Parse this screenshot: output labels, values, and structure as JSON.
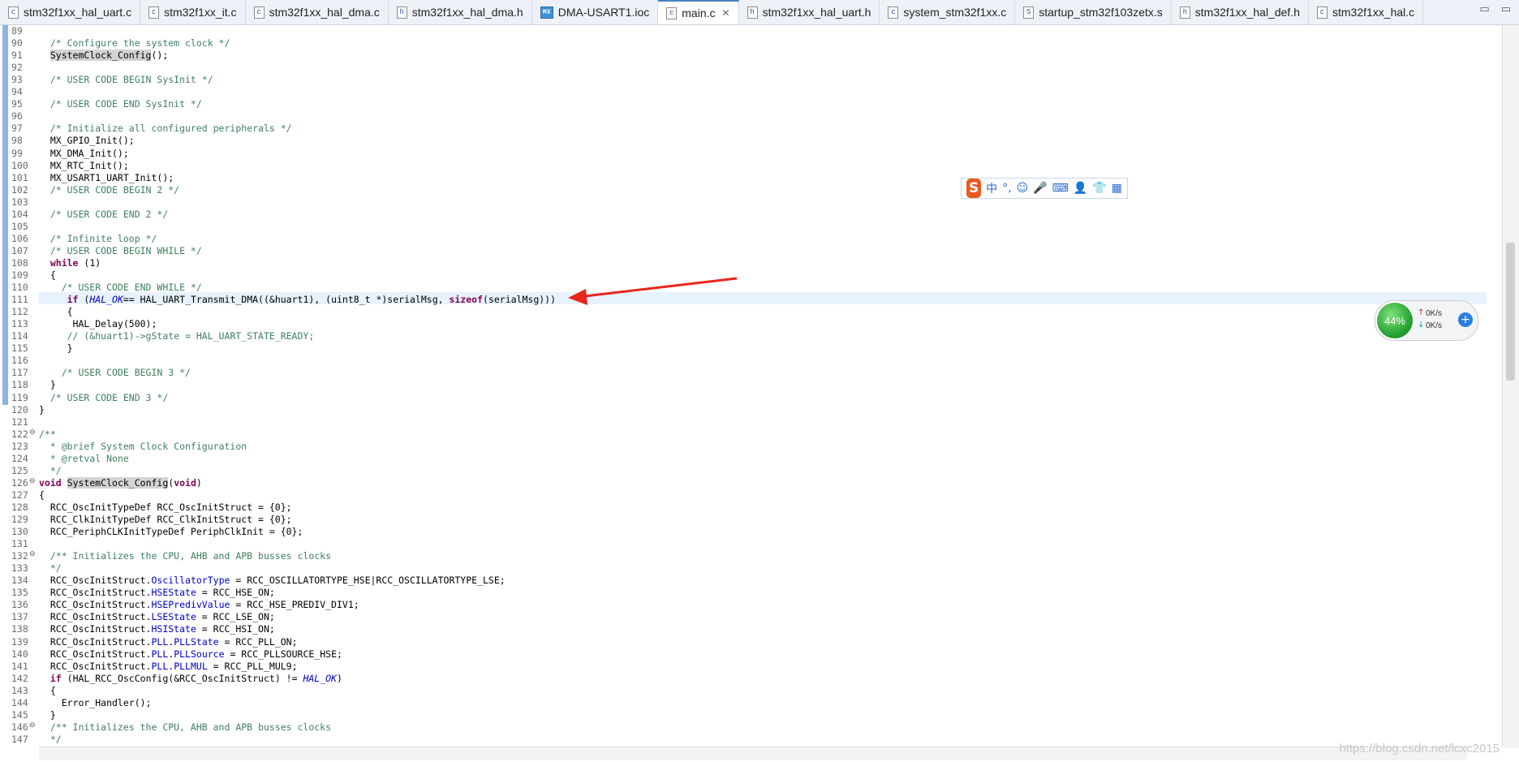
{
  "tabs": [
    {
      "icon": "c-file-icon",
      "glyph": "c",
      "label": "stm32f1xx_hal_uart.c",
      "active": false
    },
    {
      "icon": "c-file-icon",
      "glyph": "c",
      "label": "stm32f1xx_it.c",
      "active": false
    },
    {
      "icon": "c-file-icon",
      "glyph": "c",
      "label": "stm32f1xx_hal_dma.c",
      "active": false
    },
    {
      "icon": "h-file-icon",
      "glyph": "h",
      "label": "stm32f1xx_hal_dma.h",
      "active": false
    },
    {
      "icon": "mx-file-icon",
      "glyph": "MX",
      "label": "DMA-USART1.ioc",
      "active": false
    },
    {
      "icon": "c-file-icon",
      "glyph": "c",
      "label": "main.c",
      "active": true
    },
    {
      "icon": "h-file-icon",
      "glyph": "h",
      "label": "stm32f1xx_hal_uart.h",
      "active": false
    },
    {
      "icon": "c-file-icon",
      "glyph": "c",
      "label": "system_stm32f1xx.c",
      "active": false
    },
    {
      "icon": "s-file-icon",
      "glyph": "S",
      "label": "startup_stm32f103zetx.s",
      "active": false
    },
    {
      "icon": "h-file-icon",
      "glyph": "h",
      "label": "stm32f1xx_hal_def.h",
      "active": false
    },
    {
      "icon": "c-file-icon",
      "glyph": "c",
      "label": "stm32f1xx_hal.c",
      "active": false
    }
  ],
  "window_controls": {
    "minimize": "▭",
    "restore": "▭"
  },
  "code_lines": [
    {
      "n": "89",
      "t": ""
    },
    {
      "n": "90",
      "t": "  /* Configure the system clock */"
    },
    {
      "n": "91",
      "t": "  SystemClock_Config();"
    },
    {
      "n": "92",
      "t": ""
    },
    {
      "n": "93",
      "t": "  /* USER CODE BEGIN SysInit */"
    },
    {
      "n": "94",
      "t": ""
    },
    {
      "n": "95",
      "t": "  /* USER CODE END SysInit */"
    },
    {
      "n": "96",
      "t": ""
    },
    {
      "n": "97",
      "t": "  /* Initialize all configured peripherals */"
    },
    {
      "n": "98",
      "t": "  MX_GPIO_Init();"
    },
    {
      "n": "99",
      "t": "  MX_DMA_Init();"
    },
    {
      "n": "100",
      "t": "  MX_RTC_Init();"
    },
    {
      "n": "101",
      "t": "  MX_USART1_UART_Init();"
    },
    {
      "n": "102",
      "t": "  /* USER CODE BEGIN 2 */"
    },
    {
      "n": "103",
      "t": ""
    },
    {
      "n": "104",
      "t": "  /* USER CODE END 2 */"
    },
    {
      "n": "105",
      "t": ""
    },
    {
      "n": "106",
      "t": "  /* Infinite loop */"
    },
    {
      "n": "107",
      "t": "  /* USER CODE BEGIN WHILE */"
    },
    {
      "n": "108",
      "t": "  while (1)"
    },
    {
      "n": "109",
      "t": "  {"
    },
    {
      "n": "110",
      "t": "    /* USER CODE END WHILE */"
    },
    {
      "n": "111",
      "t": "     if (HAL_OK== HAL_UART_Transmit_DMA((&huart1), (uint8_t *)serialMsg, sizeof(serialMsg)))"
    },
    {
      "n": "112",
      "t": "     {"
    },
    {
      "n": "113",
      "t": "      HAL_Delay(500);"
    },
    {
      "n": "114",
      "t": "     // (&huart1)->gState = HAL_UART_STATE_READY;"
    },
    {
      "n": "115",
      "t": "     }"
    },
    {
      "n": "116",
      "t": ""
    },
    {
      "n": "117",
      "t": "    /* USER CODE BEGIN 3 */"
    },
    {
      "n": "118",
      "t": "  }"
    },
    {
      "n": "119",
      "t": "  /* USER CODE END 3 */"
    },
    {
      "n": "120",
      "t": "}"
    },
    {
      "n": "121",
      "t": ""
    },
    {
      "n": "122",
      "t": "/**"
    },
    {
      "n": "123",
      "t": "  * @brief System Clock Configuration"
    },
    {
      "n": "124",
      "t": "  * @retval None"
    },
    {
      "n": "125",
      "t": "  */"
    },
    {
      "n": "126",
      "t": "void SystemClock_Config(void)"
    },
    {
      "n": "127",
      "t": "{"
    },
    {
      "n": "128",
      "t": "  RCC_OscInitTypeDef RCC_OscInitStruct = {0};"
    },
    {
      "n": "129",
      "t": "  RCC_ClkInitTypeDef RCC_ClkInitStruct = {0};"
    },
    {
      "n": "130",
      "t": "  RCC_PeriphCLKInitTypeDef PeriphClkInit = {0};"
    },
    {
      "n": "131",
      "t": ""
    },
    {
      "n": "132",
      "t": "  /** Initializes the CPU, AHB and APB busses clocks"
    },
    {
      "n": "133",
      "t": "  */"
    },
    {
      "n": "134",
      "t": "  RCC_OscInitStruct.OscillatorType = RCC_OSCILLATORTYPE_HSE|RCC_OSCILLATORTYPE_LSE;"
    },
    {
      "n": "135",
      "t": "  RCC_OscInitStruct.HSEState = RCC_HSE_ON;"
    },
    {
      "n": "136",
      "t": "  RCC_OscInitStruct.HSEPredivValue = RCC_HSE_PREDIV_DIV1;"
    },
    {
      "n": "137",
      "t": "  RCC_OscInitStruct.LSEState = RCC_LSE_ON;"
    },
    {
      "n": "138",
      "t": "  RCC_OscInitStruct.HSIState = RCC_HSI_ON;"
    },
    {
      "n": "139",
      "t": "  RCC_OscInitStruct.PLL.PLLState = RCC_PLL_ON;"
    },
    {
      "n": "140",
      "t": "  RCC_OscInitStruct.PLL.PLLSource = RCC_PLLSOURCE_HSE;"
    },
    {
      "n": "141",
      "t": "  RCC_OscInitStruct.PLL.PLLMUL = RCC_PLL_MUL9;"
    },
    {
      "n": "142",
      "t": "  if (HAL_RCC_OscConfig(&RCC_OscInitStruct) != HAL_OK)"
    },
    {
      "n": "143",
      "t": "  {"
    },
    {
      "n": "144",
      "t": "    Error_Handler();"
    },
    {
      "n": "145",
      "t": "  }"
    },
    {
      "n": "146",
      "t": "  /** Initializes the CPU, AHB and APB busses clocks"
    },
    {
      "n": "147",
      "t": "  */"
    }
  ],
  "ime_toolbar": {
    "logo": "S",
    "items": [
      "中",
      "°,",
      "☺",
      "🎤",
      "⌨",
      "👤",
      "👕",
      "▦"
    ]
  },
  "net_widget": {
    "percent": "44%",
    "up_speed": "0K/s",
    "down_speed": "0K/s",
    "up_arrow": "↑",
    "down_arrow": "↓",
    "plus": "+"
  },
  "watermark": "https://blog.csdn.net/lcxc2015",
  "colors": {
    "comment": "#3f7f5f",
    "keyword": "#7f0055",
    "field": "#0000c0",
    "arrow": "#e8261b",
    "current_line": "#e8f2fe"
  }
}
